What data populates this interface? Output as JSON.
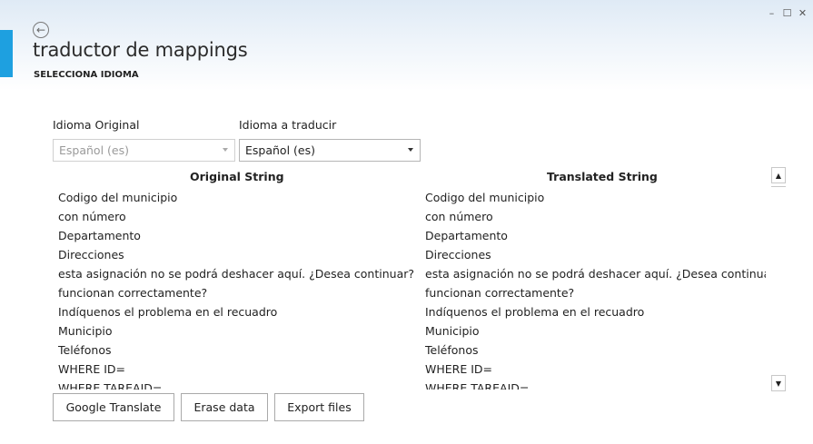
{
  "window": {
    "controls": {
      "minimize": "–",
      "maximize": "☐",
      "close": "✕"
    }
  },
  "header": {
    "back_glyph": "←",
    "title": "traductor de mappings",
    "subtitle": "SELECCIONA IDIOMA"
  },
  "form": {
    "original_label": "Idioma Original",
    "original_value": "Español (es)",
    "target_label": "Idioma a traducir",
    "target_value": "Español (es)"
  },
  "table": {
    "col_original": "Original String",
    "col_translated": "Translated String",
    "original": [
      "Codigo del municipio",
      "con número",
      "Departamento",
      "Direcciones",
      "esta asignación no se podrá deshacer aquí. ¿Desea continuar?",
      "funcionan correctamente?",
      "Indíquenos el problema en el recuadro",
      "Municipio",
      "Teléfonos",
      "WHERE ID=",
      "WHERE TAREAID="
    ],
    "translated": [
      "Codigo del municipio",
      "con número",
      "Departamento",
      "Direcciones",
      "esta asignación no se podrá deshacer aquí. ¿Desea continuar?",
      "funcionan correctamente?",
      "Indíquenos el problema en el recuadro",
      "Municipio",
      "Teléfonos",
      "WHERE ID=",
      "WHERE TAREAID="
    ],
    "scroll_up": "▲",
    "scroll_down": "▼"
  },
  "actions": {
    "google_translate": "Google Translate",
    "erase_data": "Erase data",
    "export_files": "Export files"
  },
  "colors": {
    "accent": "#1ea0e0"
  }
}
